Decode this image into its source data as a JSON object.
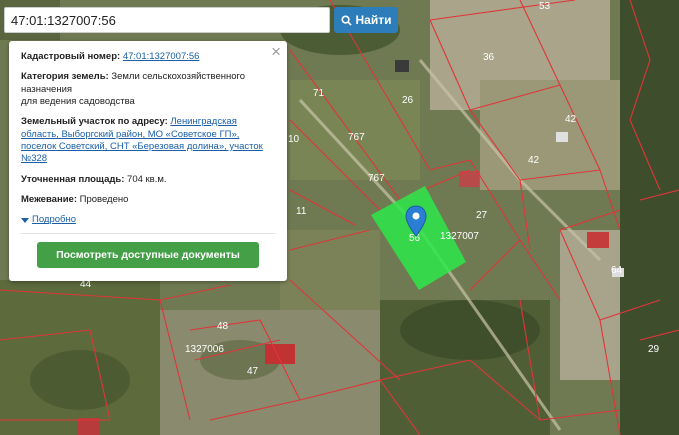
{
  "search": {
    "value": "47:01:1327007:56",
    "button_label": "Найти"
  },
  "panel": {
    "cadastral": {
      "label": "Кадастровый номер:",
      "value": "47:01:1327007:56"
    },
    "category": {
      "label": "Категория земель:",
      "value": "Земли сельскохозяйственного назначения",
      "value2": "для ведения садоводства"
    },
    "address": {
      "label": "Земельный участок по адресу:",
      "value": "Ленинградская область, Выборгский район, МО «Советское ГП», поселок Советский, СНТ «Березовая долина», участок №328"
    },
    "area": {
      "label": "Уточненная площадь:",
      "value": "704 кв.м."
    },
    "survey": {
      "label": "Межевание:",
      "value": "Проведено"
    },
    "more_label": "Подробно",
    "docs_button_label": "Посмотреть доступные документы"
  },
  "map": {
    "selected_color": "#2ee84a",
    "parcel_line_color": "#e0353a",
    "marker_color": "#2a7fd4",
    "labels": [
      {
        "id": "53",
        "text": "53"
      },
      {
        "id": "36",
        "text": "36"
      },
      {
        "id": "42a",
        "text": "42"
      },
      {
        "id": "42b",
        "text": "42"
      },
      {
        "id": "26",
        "text": "26"
      },
      {
        "id": "71",
        "text": "71"
      },
      {
        "id": "767a",
        "text": "767"
      },
      {
        "id": "767b",
        "text": "767"
      },
      {
        "id": "10",
        "text": "10"
      },
      {
        "id": "11",
        "text": "11"
      },
      {
        "id": "27",
        "text": "27"
      },
      {
        "id": "cad1",
        "text": "1327007"
      },
      {
        "id": "cad2",
        "text": "1327006"
      },
      {
        "id": "64",
        "text": "64"
      },
      {
        "id": "48",
        "text": "48"
      },
      {
        "id": "47",
        "text": "47"
      },
      {
        "id": "29",
        "text": "29"
      },
      {
        "id": "44",
        "text": "44"
      },
      {
        "id": "56",
        "text": "56"
      }
    ]
  }
}
